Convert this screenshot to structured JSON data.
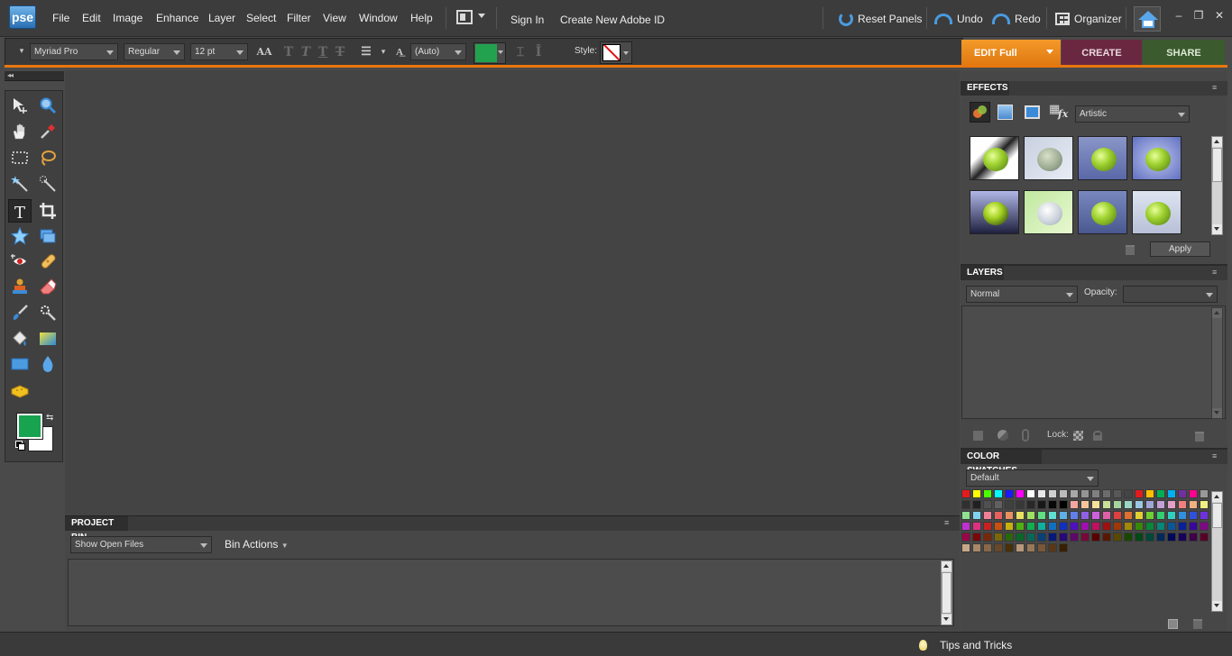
{
  "app": {
    "logo": "pse"
  },
  "menu": [
    "File",
    "Edit",
    "Image",
    "Enhance",
    "Layer",
    "Select",
    "Filter",
    "View",
    "Window",
    "Help"
  ],
  "account": {
    "sign_in": "Sign In",
    "create_id": "Create New Adobe ID"
  },
  "toolbar_right": {
    "reset_panels": "Reset Panels",
    "undo": "Undo",
    "redo": "Redo",
    "organizer": "Organizer"
  },
  "window_controls": {
    "minimize": "–",
    "restore": "❐",
    "close": "✕"
  },
  "options": {
    "font_family": "Myriad Pro",
    "font_style": "Regular",
    "font_size": "12 pt",
    "leading": "(Auto)",
    "text_color": "#22a24f",
    "style_label": "Style:"
  },
  "modes": {
    "edit": "EDIT Full",
    "create": "CREATE",
    "share": "SHARE"
  },
  "toolbox": {
    "foreground_color": "#18a350",
    "background_color": "#ffffff",
    "active_tool": "horizontal-type-tool"
  },
  "project_bin": {
    "title": "PROJECT BIN",
    "show_select": "Show Open Files",
    "bin_actions": "Bin Actions"
  },
  "effects": {
    "title": "EFFECTS",
    "category": "Artistic",
    "apply": "Apply"
  },
  "layers": {
    "title": "LAYERS",
    "blend_mode": "Normal",
    "opacity_label": "Opacity:",
    "lock_label": "Lock:"
  },
  "swatches": {
    "title": "COLOR SWATCHES",
    "preset": "Default",
    "colors": [
      "#e41a1c",
      "#ffff00",
      "#4cff00",
      "#00ffff",
      "#1a1aff",
      "#ff00ff",
      "#ffffff",
      "#e8e8e8",
      "#d0d0d0",
      "#bcbcbc",
      "#a8a8a8",
      "#949494",
      "#808080",
      "#6c6c6c",
      "#585858",
      "#444444",
      "#e41a1c",
      "#ffc000",
      "#00b050",
      "#00b0f0",
      "#7030a0",
      "#ff0090",
      "#999999",
      "#303030",
      "#202020",
      "#505050",
      "#606060",
      "#404040",
      "#383838",
      "#282828",
      "#181818",
      "#080808",
      "#000000",
      "#f4a6a0",
      "#f6c49a",
      "#f8e29a",
      "#c8e29a",
      "#a6d6a0",
      "#9ad6c4",
      "#9ac8e2",
      "#a0a6d6",
      "#c4a0d6",
      "#e2a0c8",
      "#f08080",
      "#f0b080",
      "#f0f080",
      "#90e090",
      "#80d0f0",
      "#f08098",
      "#e86060",
      "#e89060",
      "#e8e060",
      "#a0e060",
      "#60e080",
      "#60e0d0",
      "#60b0e8",
      "#6080e8",
      "#9060e8",
      "#d060e0",
      "#e060a8",
      "#e04040",
      "#e07030",
      "#e0d030",
      "#70d030",
      "#30d070",
      "#30d0c0",
      "#3090e0",
      "#3050e0",
      "#7030e0",
      "#c030d0",
      "#e03080",
      "#c82020",
      "#c85010",
      "#c8b010",
      "#50b010",
      "#10b050",
      "#10b0a0",
      "#1070c0",
      "#1030c0",
      "#5010c0",
      "#a010b0",
      "#c01060",
      "#a01010",
      "#a03808",
      "#a08808",
      "#388808",
      "#088838",
      "#088878",
      "#085898",
      "#082098",
      "#380898",
      "#800888",
      "#980848",
      "#780808",
      "#782808",
      "#786808",
      "#286808",
      "#086828",
      "#086858",
      "#084078",
      "#081878",
      "#280878",
      "#600868",
      "#780838",
      "#580000",
      "#581800",
      "#584800",
      "#184800",
      "#004818",
      "#004838",
      "#002858",
      "#000858",
      "#180058",
      "#400048",
      "#580028",
      "#c8a888",
      "#a88868",
      "#886848",
      "#684828",
      "#483008",
      "#b89878",
      "#987858",
      "#785838",
      "#583818",
      "#382000"
    ]
  }
}
